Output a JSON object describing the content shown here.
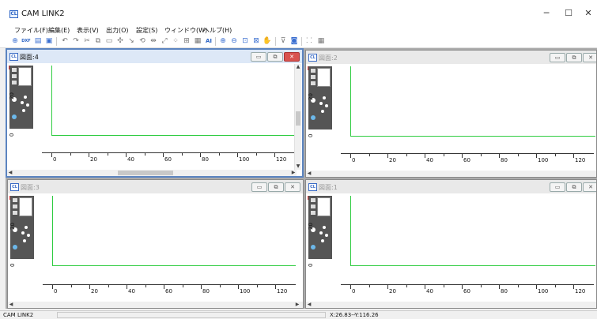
{
  "app": {
    "title": "CAM LINK2",
    "icon_text": "CL"
  },
  "window_controls": {
    "minimize": "─",
    "maximize": "☐",
    "close": "✕"
  },
  "menu": [
    "ファイル(F)",
    "編集(E)",
    "表示(V)",
    "出力(O)",
    "設定(S)",
    "ウィンドウ(W)",
    "ヘルプ(H)"
  ],
  "toolbar": {
    "dxf_label": "DXF",
    "ai_label": "AI",
    "icons": [
      "new-icon",
      "dxf-icon",
      "open-icon",
      "save-icon",
      "undo-icon",
      "redo-icon",
      "cut-icon",
      "copy-icon",
      "paste-icon",
      "move-icon",
      "node-icon",
      "rotate-icon",
      "mirror-icon",
      "scale-icon",
      "array-icon",
      "group-icon",
      "layer-icon",
      "text-ai-icon",
      "zoom-in-icon",
      "zoom-out-icon",
      "zoom-fit-icon",
      "zoom-window-icon",
      "pan-icon",
      "filter-icon",
      "preview-icon",
      "grid-icon",
      "settings-icon"
    ]
  },
  "windows": [
    {
      "title": "図面:4",
      "active": true
    },
    {
      "title": "図面:2",
      "active": false
    },
    {
      "title": "図面:3",
      "active": false
    },
    {
      "title": "図面:1",
      "active": false
    }
  ],
  "child_buttons": {
    "minimize": "▭",
    "restore": "⧉",
    "close": "✕"
  },
  "canvas": {
    "y_label": "20",
    "y_zero": "0",
    "x_ticks": [
      "0",
      "20",
      "40",
      "60",
      "80",
      "100",
      "120"
    ]
  },
  "status": {
    "left": "CAM LINK2",
    "coords": "X:26.83--Y:116.26"
  },
  "colors": {
    "accent": "#3b6fd0",
    "green_line": "#2ecc40",
    "mdi_bg": "#ababab",
    "active_border": "#5b84c0"
  }
}
